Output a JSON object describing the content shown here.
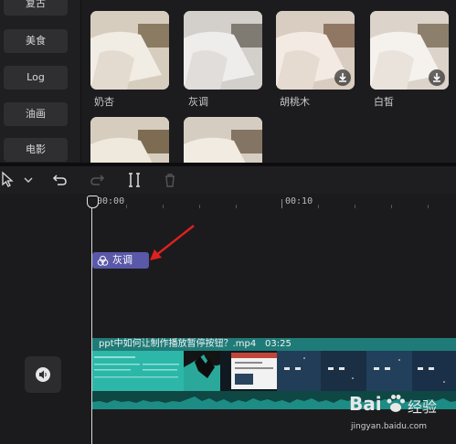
{
  "categories": [
    "复古",
    "美食",
    "Log",
    "油画",
    "电影"
  ],
  "filters": [
    {
      "label": "奶杏",
      "downloadable": false
    },
    {
      "label": "灰调",
      "downloadable": false
    },
    {
      "label": "胡桃木",
      "downloadable": true
    },
    {
      "label": "白皙",
      "downloadable": true
    },
    {
      "label": "",
      "downloadable": false
    },
    {
      "label": "",
      "downloadable": false
    }
  ],
  "toolbar": {
    "tools": [
      "select-pointer-icon",
      "chevron-down-icon",
      "undo-icon",
      "redo-icon",
      "split-icon",
      "delete-icon"
    ]
  },
  "timeline": {
    "ruler": [
      "00:00",
      "00:10"
    ],
    "filter_clip": {
      "label": "灰调"
    },
    "video_clip": {
      "name": "ppt中如何让制作播放暂停按钮？.mp4",
      "duration": "03:25"
    }
  },
  "watermark": {
    "brand": "Bai",
    "brand_cn": "经验",
    "url": "jingyan.baidu.com"
  },
  "colors": {
    "accent": "#5a58a8",
    "track": "#1f7b78",
    "arrow": "#e02020"
  }
}
